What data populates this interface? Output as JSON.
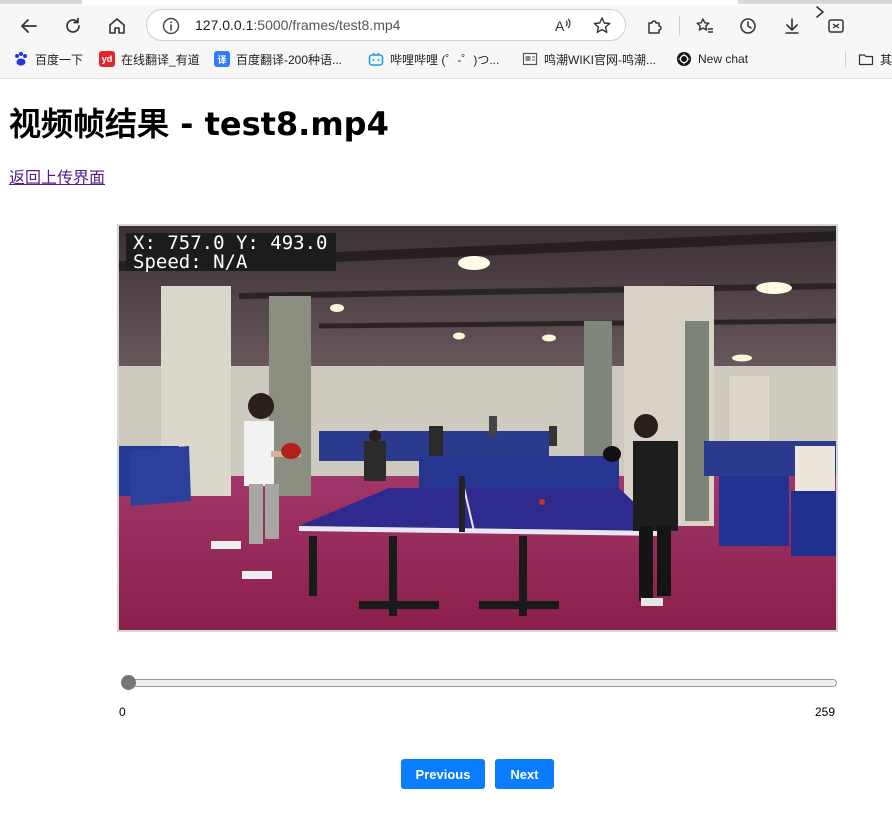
{
  "browser": {
    "url_host": "127.0.0.1",
    "url_rest": ":5000/frames/test8.mp4",
    "bookmarks": [
      {
        "label": "百度一下",
        "icon": "baidu-icon",
        "color": "#2932e1"
      },
      {
        "label": "在线翻译_有道",
        "icon": "youdao-icon",
        "color": "#e1262d",
        "badge": "yd"
      },
      {
        "label": "百度翻译-200种语...",
        "icon": "baidu-translate-icon",
        "color": "#2f7df6",
        "badge": "译"
      },
      {
        "label": "哔哩哔哩 (゜-゜)つ...",
        "icon": "bilibili-icon",
        "color": "#1aa1e0"
      },
      {
        "label": "鸣潮WIKI官网-鸣潮...",
        "icon": "wiki-icon",
        "color": "#555555"
      },
      {
        "label": "New chat",
        "icon": "openai-icon",
        "color": "#111111"
      }
    ],
    "bookmark_folder_label": "其"
  },
  "page": {
    "title": "视频帧结果 - test8.mp4",
    "back_link": "返回上传界面",
    "overlay_line1": "X: 757.0  Y: 493.0",
    "overlay_line2": "Speed: N/A",
    "slider": {
      "min": "0",
      "max": "259",
      "value": 0
    },
    "prev_label": "Previous",
    "next_label": "Next"
  },
  "colors": {
    "accent": "#0a7cff",
    "link_visited": "#551a8b"
  }
}
